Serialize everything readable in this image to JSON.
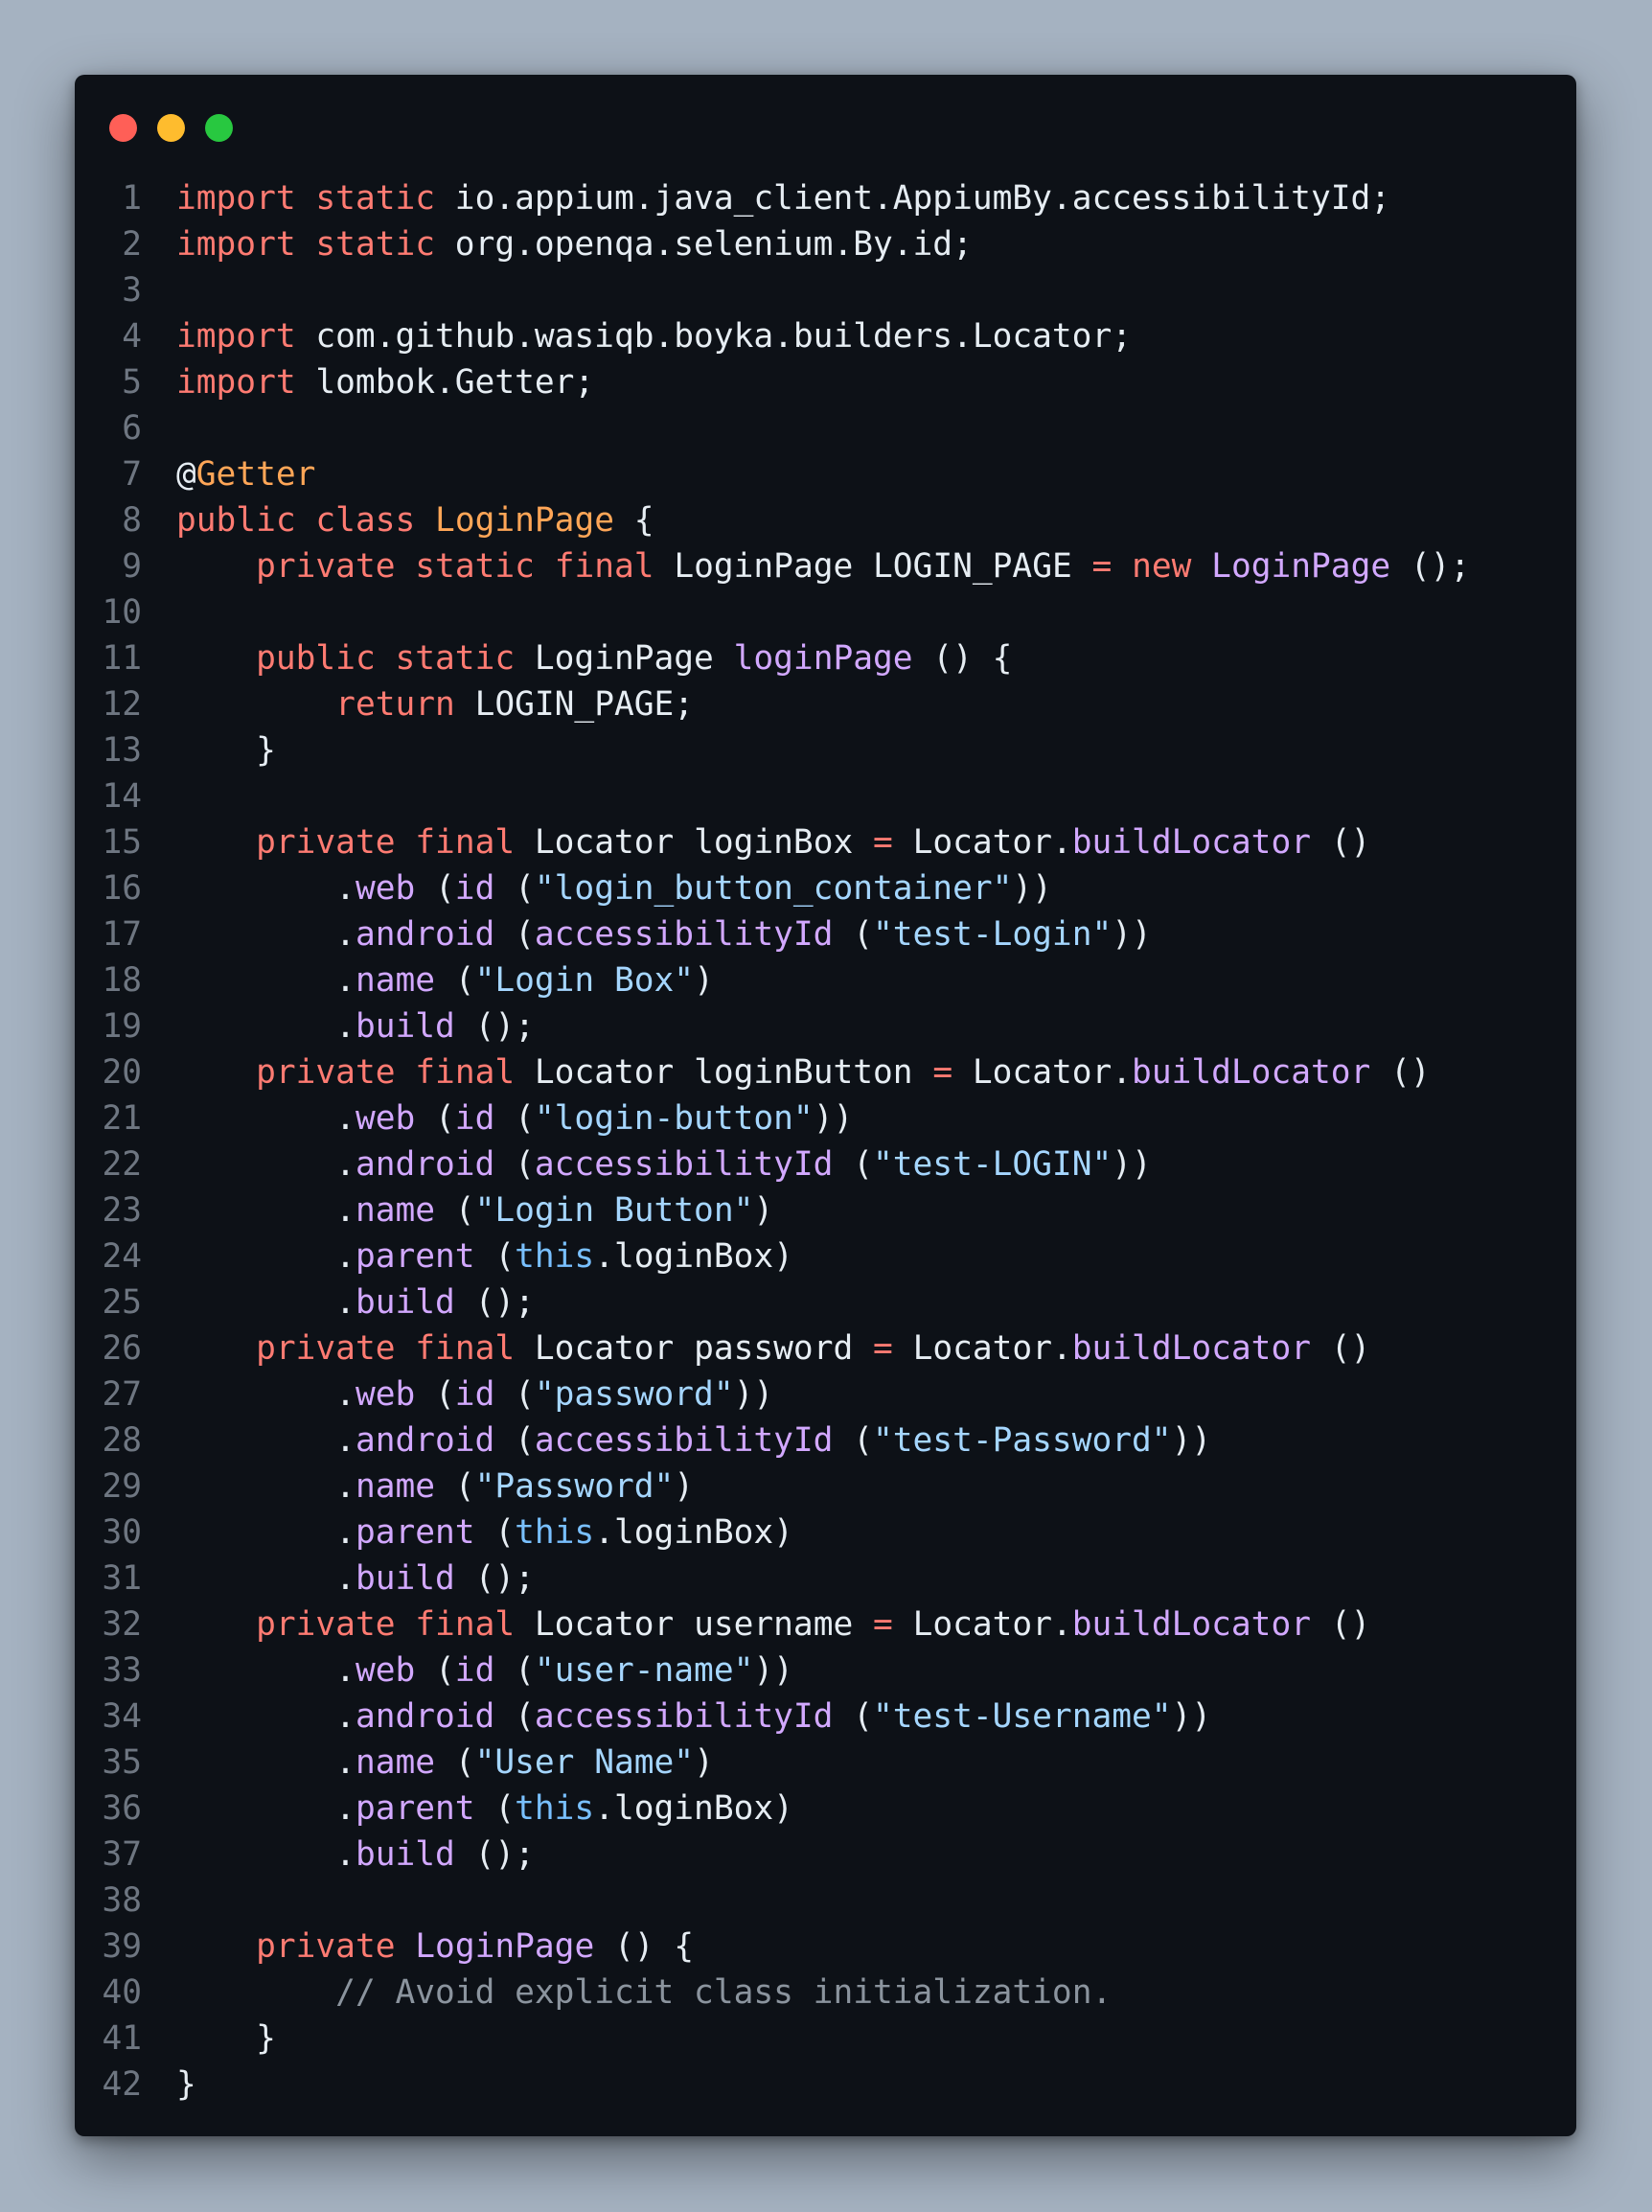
{
  "window": {
    "controls": [
      {
        "name": "close-button",
        "color": "#ff5f57"
      },
      {
        "name": "minimize-button",
        "color": "#febc2e"
      },
      {
        "name": "maximize-button",
        "color": "#28c840"
      }
    ]
  },
  "code": {
    "language": "java",
    "lines": [
      [
        [
          "kw",
          "import"
        ],
        [
          "p",
          " "
        ],
        [
          "kw",
          "static"
        ],
        [
          "p",
          " io.appium.java_client.AppiumBy.accessibilityId;"
        ]
      ],
      [
        [
          "kw",
          "import"
        ],
        [
          "p",
          " "
        ],
        [
          "kw",
          "static"
        ],
        [
          "p",
          " org.openqa.selenium.By.id;"
        ]
      ],
      [],
      [
        [
          "kw",
          "import"
        ],
        [
          "p",
          " com.github.wasiqb.boyka.builders.Locator;"
        ]
      ],
      [
        [
          "kw",
          "import"
        ],
        [
          "p",
          " lombok.Getter;"
        ]
      ],
      [],
      [
        [
          "p",
          "@"
        ],
        [
          "ty",
          "Getter"
        ]
      ],
      [
        [
          "kw",
          "public"
        ],
        [
          "p",
          " "
        ],
        [
          "kw",
          "class"
        ],
        [
          "p",
          " "
        ],
        [
          "ty",
          "LoginPage"
        ],
        [
          "p",
          " {"
        ]
      ],
      [
        [
          "p",
          "    "
        ],
        [
          "kw",
          "private"
        ],
        [
          "p",
          " "
        ],
        [
          "kw",
          "static"
        ],
        [
          "p",
          " "
        ],
        [
          "kw",
          "final"
        ],
        [
          "p",
          " LoginPage LOGIN_PAGE "
        ],
        [
          "kw",
          "="
        ],
        [
          "p",
          " "
        ],
        [
          "kw",
          "new"
        ],
        [
          "p",
          " "
        ],
        [
          "fn",
          "LoginPage"
        ],
        [
          "p",
          " ();"
        ]
      ],
      [],
      [
        [
          "p",
          "    "
        ],
        [
          "kw",
          "public"
        ],
        [
          "p",
          " "
        ],
        [
          "kw",
          "static"
        ],
        [
          "p",
          " LoginPage "
        ],
        [
          "fn",
          "loginPage"
        ],
        [
          "p",
          " () {"
        ]
      ],
      [
        [
          "p",
          "        "
        ],
        [
          "kw",
          "return"
        ],
        [
          "p",
          " LOGIN_PAGE;"
        ]
      ],
      [
        [
          "p",
          "    }"
        ]
      ],
      [],
      [
        [
          "p",
          "    "
        ],
        [
          "kw",
          "private"
        ],
        [
          "p",
          " "
        ],
        [
          "kw",
          "final"
        ],
        [
          "p",
          " Locator loginBox "
        ],
        [
          "kw",
          "="
        ],
        [
          "p",
          " Locator."
        ],
        [
          "fn",
          "buildLocator"
        ],
        [
          "p",
          " ()"
        ]
      ],
      [
        [
          "p",
          "        ."
        ],
        [
          "fn",
          "web"
        ],
        [
          "p",
          " ("
        ],
        [
          "fn",
          "id"
        ],
        [
          "p",
          " ("
        ],
        [
          "st",
          "\"login_button_container\""
        ],
        [
          "p",
          "))"
        ]
      ],
      [
        [
          "p",
          "        ."
        ],
        [
          "fn",
          "android"
        ],
        [
          "p",
          " ("
        ],
        [
          "fn",
          "accessibilityId"
        ],
        [
          "p",
          " ("
        ],
        [
          "st",
          "\"test-Login\""
        ],
        [
          "p",
          "))"
        ]
      ],
      [
        [
          "p",
          "        ."
        ],
        [
          "fn",
          "name"
        ],
        [
          "p",
          " ("
        ],
        [
          "st",
          "\"Login Box\""
        ],
        [
          "p",
          ")"
        ]
      ],
      [
        [
          "p",
          "        ."
        ],
        [
          "fn",
          "build"
        ],
        [
          "p",
          " ();"
        ]
      ],
      [
        [
          "p",
          "    "
        ],
        [
          "kw",
          "private"
        ],
        [
          "p",
          " "
        ],
        [
          "kw",
          "final"
        ],
        [
          "p",
          " Locator loginButton "
        ],
        [
          "kw",
          "="
        ],
        [
          "p",
          " Locator."
        ],
        [
          "fn",
          "buildLocator"
        ],
        [
          "p",
          " ()"
        ]
      ],
      [
        [
          "p",
          "        ."
        ],
        [
          "fn",
          "web"
        ],
        [
          "p",
          " ("
        ],
        [
          "fn",
          "id"
        ],
        [
          "p",
          " ("
        ],
        [
          "st",
          "\"login-button\""
        ],
        [
          "p",
          "))"
        ]
      ],
      [
        [
          "p",
          "        ."
        ],
        [
          "fn",
          "android"
        ],
        [
          "p",
          " ("
        ],
        [
          "fn",
          "accessibilityId"
        ],
        [
          "p",
          " ("
        ],
        [
          "st",
          "\"test-LOGIN\""
        ],
        [
          "p",
          "))"
        ]
      ],
      [
        [
          "p",
          "        ."
        ],
        [
          "fn",
          "name"
        ],
        [
          "p",
          " ("
        ],
        [
          "st",
          "\"Login Button\""
        ],
        [
          "p",
          ")"
        ]
      ],
      [
        [
          "p",
          "        ."
        ],
        [
          "fn",
          "parent"
        ],
        [
          "p",
          " ("
        ],
        [
          "th",
          "this"
        ],
        [
          "p",
          ".loginBox)"
        ]
      ],
      [
        [
          "p",
          "        ."
        ],
        [
          "fn",
          "build"
        ],
        [
          "p",
          " ();"
        ]
      ],
      [
        [
          "p",
          "    "
        ],
        [
          "kw",
          "private"
        ],
        [
          "p",
          " "
        ],
        [
          "kw",
          "final"
        ],
        [
          "p",
          " Locator password "
        ],
        [
          "kw",
          "="
        ],
        [
          "p",
          " Locator."
        ],
        [
          "fn",
          "buildLocator"
        ],
        [
          "p",
          " ()"
        ]
      ],
      [
        [
          "p",
          "        ."
        ],
        [
          "fn",
          "web"
        ],
        [
          "p",
          " ("
        ],
        [
          "fn",
          "id"
        ],
        [
          "p",
          " ("
        ],
        [
          "st",
          "\"password\""
        ],
        [
          "p",
          "))"
        ]
      ],
      [
        [
          "p",
          "        ."
        ],
        [
          "fn",
          "android"
        ],
        [
          "p",
          " ("
        ],
        [
          "fn",
          "accessibilityId"
        ],
        [
          "p",
          " ("
        ],
        [
          "st",
          "\"test-Password\""
        ],
        [
          "p",
          "))"
        ]
      ],
      [
        [
          "p",
          "        ."
        ],
        [
          "fn",
          "name"
        ],
        [
          "p",
          " ("
        ],
        [
          "st",
          "\"Password\""
        ],
        [
          "p",
          ")"
        ]
      ],
      [
        [
          "p",
          "        ."
        ],
        [
          "fn",
          "parent"
        ],
        [
          "p",
          " ("
        ],
        [
          "th",
          "this"
        ],
        [
          "p",
          ".loginBox)"
        ]
      ],
      [
        [
          "p",
          "        ."
        ],
        [
          "fn",
          "build"
        ],
        [
          "p",
          " ();"
        ]
      ],
      [
        [
          "p",
          "    "
        ],
        [
          "kw",
          "private"
        ],
        [
          "p",
          " "
        ],
        [
          "kw",
          "final"
        ],
        [
          "p",
          " Locator username "
        ],
        [
          "kw",
          "="
        ],
        [
          "p",
          " Locator."
        ],
        [
          "fn",
          "buildLocator"
        ],
        [
          "p",
          " ()"
        ]
      ],
      [
        [
          "p",
          "        ."
        ],
        [
          "fn",
          "web"
        ],
        [
          "p",
          " ("
        ],
        [
          "fn",
          "id"
        ],
        [
          "p",
          " ("
        ],
        [
          "st",
          "\"user-name\""
        ],
        [
          "p",
          "))"
        ]
      ],
      [
        [
          "p",
          "        ."
        ],
        [
          "fn",
          "android"
        ],
        [
          "p",
          " ("
        ],
        [
          "fn",
          "accessibilityId"
        ],
        [
          "p",
          " ("
        ],
        [
          "st",
          "\"test-Username\""
        ],
        [
          "p",
          "))"
        ]
      ],
      [
        [
          "p",
          "        ."
        ],
        [
          "fn",
          "name"
        ],
        [
          "p",
          " ("
        ],
        [
          "st",
          "\"User Name\""
        ],
        [
          "p",
          ")"
        ]
      ],
      [
        [
          "p",
          "        ."
        ],
        [
          "fn",
          "parent"
        ],
        [
          "p",
          " ("
        ],
        [
          "th",
          "this"
        ],
        [
          "p",
          ".loginBox)"
        ]
      ],
      [
        [
          "p",
          "        ."
        ],
        [
          "fn",
          "build"
        ],
        [
          "p",
          " ();"
        ]
      ],
      [],
      [
        [
          "p",
          "    "
        ],
        [
          "kw",
          "private"
        ],
        [
          "p",
          " "
        ],
        [
          "fn",
          "LoginPage"
        ],
        [
          "p",
          " () {"
        ]
      ],
      [
        [
          "p",
          "        "
        ],
        [
          "cm",
          "// Avoid explicit class initialization."
        ]
      ],
      [
        [
          "p",
          "    }"
        ]
      ],
      [
        [
          "p",
          "}"
        ]
      ]
    ]
  }
}
